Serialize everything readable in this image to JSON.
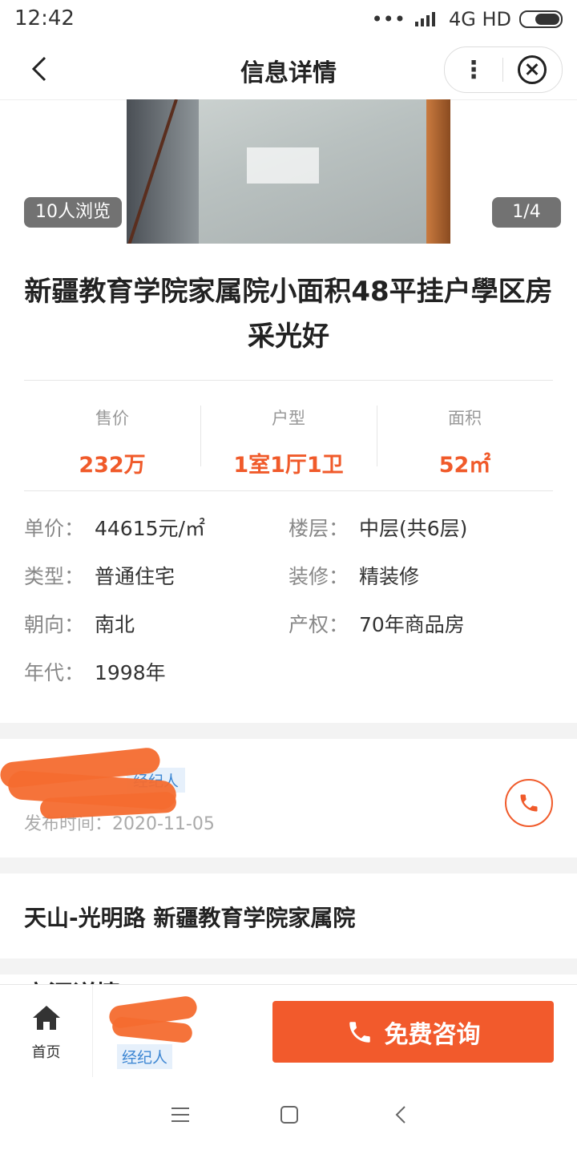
{
  "status_bar": {
    "time": "12:42",
    "signal_dots": "•••",
    "network": "4G HD"
  },
  "nav": {
    "title": "信息详情",
    "more_glyph": "⋮"
  },
  "gallery": {
    "views": "10人浏览",
    "page_indicator": "1/4"
  },
  "listing": {
    "title": "新疆教育学院家属院小面积48平挂户學区房 采光好"
  },
  "stats": [
    {
      "label": "售价",
      "value": "232万"
    },
    {
      "label": "户型",
      "value": "1室1厅1卫"
    },
    {
      "label": "面积",
      "value": "52㎡"
    }
  ],
  "details": {
    "unit_price": {
      "key": "单价：",
      "value": "44615元/㎡"
    },
    "floor": {
      "key": "楼层：",
      "value": "中层(共6层)"
    },
    "type": {
      "key": "类型：",
      "value": "普通住宅"
    },
    "decoration": {
      "key": "装修：",
      "value": "精装修"
    },
    "orientation": {
      "key": "朝向：",
      "value": "南北"
    },
    "property_right": {
      "key": "产权：",
      "value": "70年商品房"
    },
    "year": {
      "key": "年代：",
      "value": "1998年"
    }
  },
  "agent": {
    "tag": "经纪人",
    "publish_time": "发布时间：2020-11-05"
  },
  "location": {
    "text": "天山-光明路 新疆教育学院家属院"
  },
  "section_peek": "房源详情",
  "bottom": {
    "home_label": "首页",
    "agent_tag": "经纪人",
    "consult_label": "免费咨询"
  },
  "colors": {
    "accent": "#f25a2c",
    "tag_blue": "#3e87d3"
  }
}
